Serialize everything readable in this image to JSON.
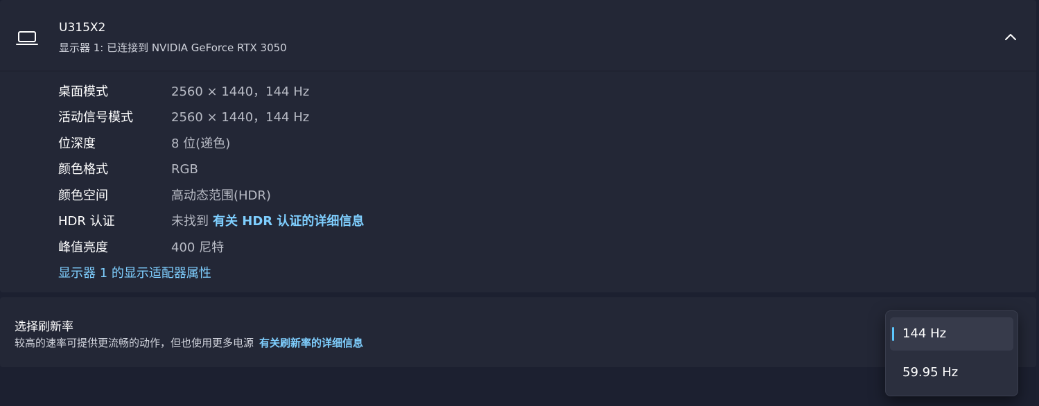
{
  "display": {
    "name": "U315X2",
    "subtitle": "显示器 1: 已连接到 NVIDIA GeForce RTX 3050",
    "details": [
      {
        "label": "桌面模式",
        "value": "2560 × 1440，144 Hz"
      },
      {
        "label": "活动信号模式",
        "value": "2560 × 1440，144 Hz"
      },
      {
        "label": "位深度",
        "value": "8 位(递色)"
      },
      {
        "label": "颜色格式",
        "value": "RGB"
      },
      {
        "label": "颜色空间",
        "value": "高动态范围(HDR)"
      },
      {
        "label": "HDR 认证",
        "value": "未找到",
        "link": "有关 HDR 认证的详细信息"
      },
      {
        "label": "峰值亮度",
        "value": "400 尼特"
      }
    ],
    "adapter_link": "显示器 1 的显示适配器属性"
  },
  "refresh": {
    "title": "选择刷新率",
    "description": "较高的速率可提供更流畅的动作，但也使用更多电源",
    "link": "有关刷新率的详细信息",
    "options": [
      "144 Hz",
      "59.95 Hz"
    ],
    "selected": "144 Hz"
  },
  "colors": {
    "accent": "#5cc8ff",
    "link": "#7fcfff",
    "card": "#232736",
    "background": "#1c2030"
  },
  "icons": {
    "monitor": "laptop-icon",
    "collapse": "chevron-up-icon"
  }
}
